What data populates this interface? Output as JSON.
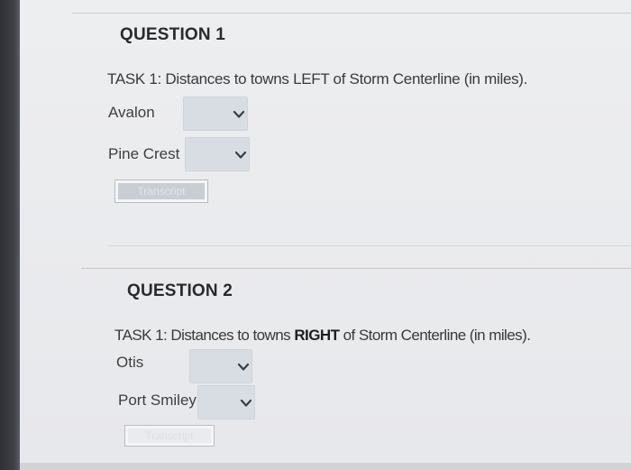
{
  "questions": [
    {
      "title": "QUESTION 1",
      "task_prefix": "TASK 1: Distances to towns ",
      "task_emphasis": "LEFT",
      "task_suffix": " of Storm Centerline (in miles).",
      "rows": [
        {
          "label": "Avalon",
          "value": ""
        },
        {
          "label": "Pine Crest",
          "value": ""
        }
      ],
      "button_label": "Transcript"
    },
    {
      "title": "QUESTION 2",
      "task_prefix": "TASK 1: Distances to towns ",
      "task_emphasis": "RIGHT",
      "task_suffix": " of Storm Centerline (in miles).",
      "rows": [
        {
          "label": "Otis",
          "value": ""
        },
        {
          "label": "Port Smiley",
          "value": ""
        }
      ],
      "button_label": "Transcript"
    }
  ],
  "icons": {
    "dropdown": "chevron-down-icon"
  }
}
